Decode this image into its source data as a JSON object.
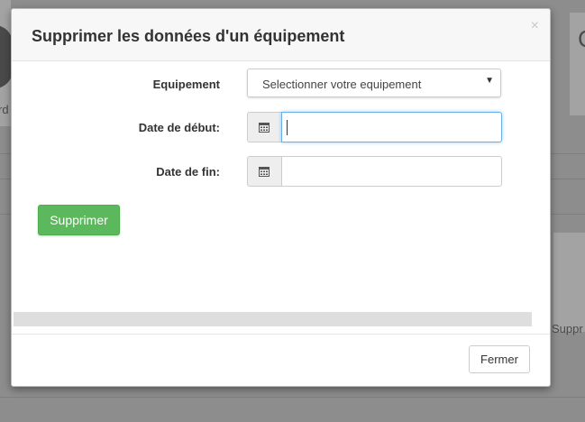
{
  "background": {
    "left_text": "rd",
    "right_text": "Suppr",
    "right_top_text": "C"
  },
  "modal": {
    "title": "Supprimer les données d'un équipement",
    "close_symbol": "×",
    "fields": {
      "equipement_label": "Equipement",
      "equipement_value": "Selectionner votre equipement",
      "date_debut_label": "Date de début:",
      "date_debut_value": "",
      "date_fin_label": "Date de fin:",
      "date_fin_value": ""
    },
    "submit_label": "Supprimer",
    "close_label": "Fermer"
  },
  "colors": {
    "submit": "#5cb85c",
    "focus": "#66afe9"
  }
}
